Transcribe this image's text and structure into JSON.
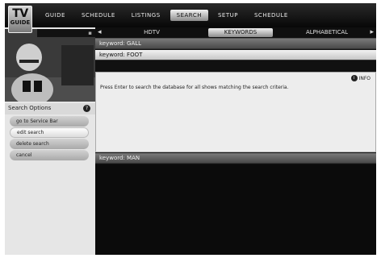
{
  "logo": {
    "line1": "TV",
    "line2": "GUIDE"
  },
  "top_nav": [
    {
      "label": "GUIDE",
      "selected": false
    },
    {
      "label": "SCHEDULE",
      "selected": false
    },
    {
      "label": "LISTINGS",
      "selected": false
    },
    {
      "label": "SEARCH",
      "selected": true
    },
    {
      "label": "SETUP",
      "selected": false
    },
    {
      "label": "SCHEDULE",
      "selected": false
    }
  ],
  "sub_tabs": [
    {
      "label": "HDTV",
      "selected": false
    },
    {
      "label": "KEYWORDS",
      "selected": true
    },
    {
      "label": "ALPHABETICAL",
      "selected": false
    }
  ],
  "search_options": {
    "title": "Search Options",
    "help_icon": "?",
    "items": [
      {
        "label": "go to Service Bar",
        "selected": false
      },
      {
        "label": "edit search",
        "selected": true
      },
      {
        "label": "delete search",
        "selected": false
      },
      {
        "label": "cancel",
        "selected": false
      }
    ]
  },
  "keywords": [
    {
      "label": "keyword: GALL",
      "highlighted": false
    },
    {
      "label": "keyword: FOOT",
      "highlighted": true
    }
  ],
  "panel": {
    "info_label": "INFO",
    "info_icon": "i",
    "message": "Press Enter to search the database for all shows matching the search criteria."
  },
  "keyword_bottom": {
    "label": "keyword: MAN"
  },
  "colors": {
    "highlight": "#e8e8e8",
    "bar": "#5a5a5a",
    "background": "#0c0c0c"
  }
}
